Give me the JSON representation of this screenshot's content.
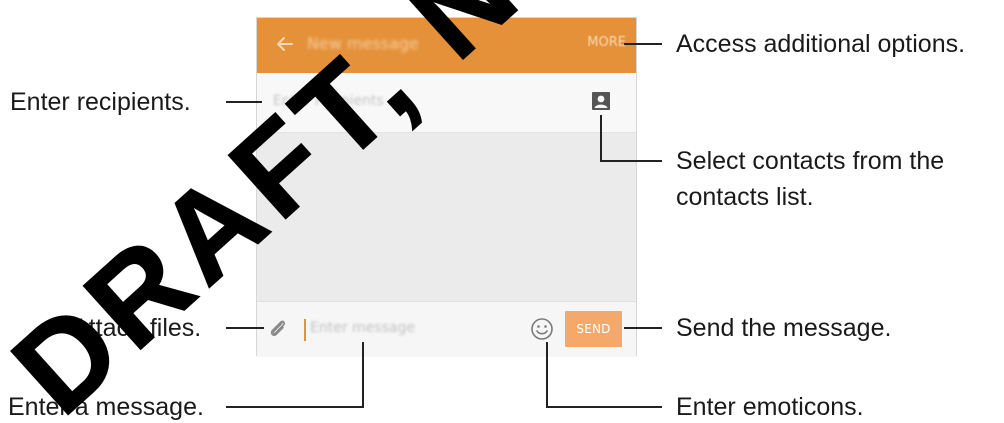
{
  "screen": {
    "appbar": {
      "back_icon": "arrow-left-icon",
      "title": "New message",
      "more_label": "MORE"
    },
    "recipients": {
      "placeholder": "Enter recipients",
      "contacts_icon": "contact-card-icon"
    },
    "composer": {
      "attach_icon": "paperclip-icon",
      "placeholder": "Enter message",
      "emoticon_icon": "smiley-icon",
      "send_label": "SEND"
    },
    "colors": {
      "accent": "#e4913a",
      "send": "#f4a86a"
    }
  },
  "callouts": {
    "more": "Access additional options.",
    "recipients": "Enter recipients.",
    "contacts_line1": "Select contacts from the",
    "contacts_line2": "contacts list.",
    "attach": "Attach files.",
    "send": "Send the message.",
    "message": "Enter a message.",
    "emoticons": "Enter emoticons."
  },
  "watermark": "DRAFT, Not"
}
